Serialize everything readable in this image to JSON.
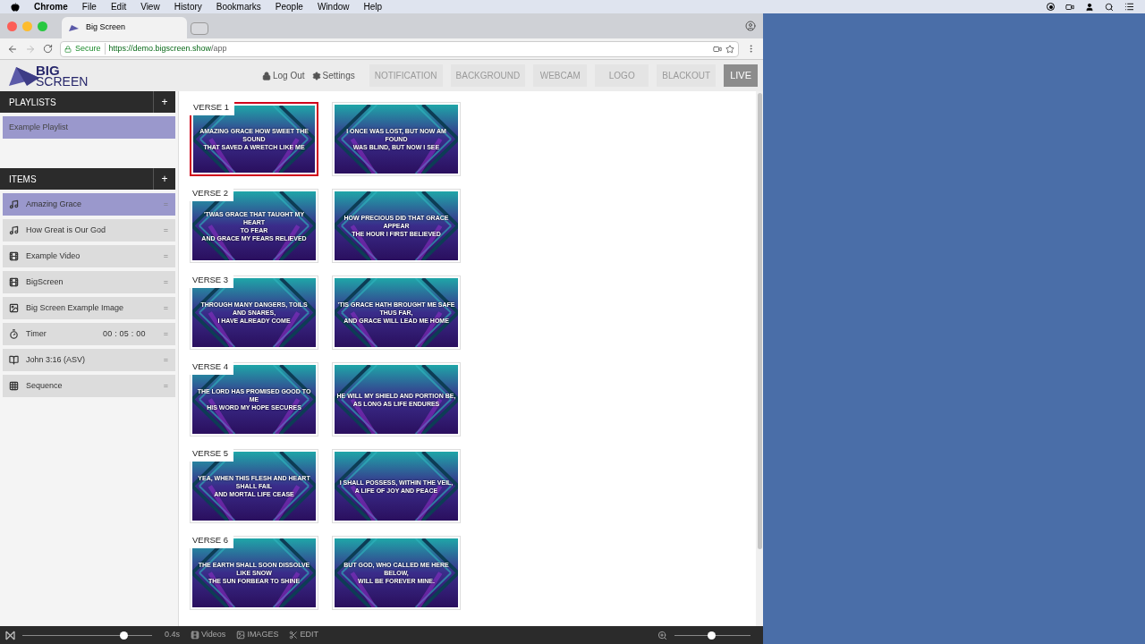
{
  "menubar": {
    "app": "Chrome",
    "menus": [
      "File",
      "Edit",
      "View",
      "History",
      "Bookmarks",
      "People",
      "Window",
      "Help"
    ]
  },
  "browser": {
    "tab_title": "Big Screen",
    "secure": "Secure",
    "url_host": "https://demo.bigscreen.show",
    "url_path": "/app"
  },
  "header": {
    "logo_top": "BIG",
    "logo_bottom": "SCREEN",
    "links": [
      {
        "kind": "lock",
        "label": "Log Out"
      },
      {
        "kind": "gear",
        "label": "Settings"
      }
    ],
    "buttons": [
      {
        "label": "NOTIFICATION",
        "disabled": true
      },
      {
        "label": "BACKGROUND",
        "disabled": true
      },
      {
        "label": "WEBCAM",
        "disabled": true
      },
      {
        "label": "LOGO",
        "disabled": true
      },
      {
        "label": "BLACKOUT",
        "disabled": true
      },
      {
        "label": "LIVE",
        "disabled": false
      }
    ]
  },
  "playlists": {
    "title": "PLAYLISTS",
    "add": "+",
    "items": [
      {
        "label": "Example Playlist",
        "selected": true
      }
    ]
  },
  "items": {
    "title": "ITEMS",
    "add": "+",
    "items": [
      {
        "kind": "music",
        "label": "Amazing Grace",
        "selected": true,
        "handle": "="
      },
      {
        "kind": "music",
        "label": "How Great is Our God",
        "selected": false,
        "handle": "="
      },
      {
        "kind": "video",
        "label": "Example Video",
        "selected": false,
        "handle": "="
      },
      {
        "kind": "video",
        "label": "BigScreen",
        "selected": false,
        "handle": "="
      },
      {
        "kind": "image",
        "label": "Big Screen Example Image",
        "selected": false,
        "handle": "="
      },
      {
        "kind": "timer",
        "label": "Timer",
        "value": "00 : 05 : 00",
        "selected": false,
        "handle": "="
      },
      {
        "kind": "book",
        "label": "John 3:16 (ASV)",
        "selected": false,
        "handle": "="
      },
      {
        "kind": "grid",
        "label": "Sequence",
        "selected": false,
        "handle": "="
      }
    ]
  },
  "verses": [
    {
      "label": "VERSE 1",
      "slides": [
        {
          "text": "AMAZING GRACE HOW SWEET THE SOUND\nTHAT SAVED A WRETCH LIKE ME",
          "selected": true
        },
        {
          "text": "I ONCE WAS LOST, BUT NOW AM FOUND\nWAS BLIND, BUT NOW I SEE",
          "selected": false
        }
      ]
    },
    {
      "label": "VERSE 2",
      "slides": [
        {
          "text": "'TWAS GRACE THAT TAUGHT MY HEART\nTO FEAR\nAND GRACE MY FEARS RELIEVED",
          "selected": false
        },
        {
          "text": "HOW PRECIOUS DID THAT GRACE APPEAR\nTHE HOUR I FIRST BELIEVED",
          "selected": false
        }
      ]
    },
    {
      "label": "VERSE 3",
      "slides": [
        {
          "text": "THROUGH MANY DANGERS, TOILS\nAND SNARES,\nI HAVE ALREADY COME",
          "selected": false
        },
        {
          "text": "'TIS GRACE HATH BROUGHT ME SAFE\nTHUS FAR,\nAND GRACE WILL LEAD ME HOME",
          "selected": false
        }
      ]
    },
    {
      "label": "VERSE 4",
      "slides": [
        {
          "text": "THE LORD HAS PROMISED GOOD TO ME\nHIS WORD MY HOPE SECURES",
          "selected": false
        },
        {
          "text": "HE WILL MY SHIELD AND PORTION BE,\nAS LONG AS LIFE ENDURES",
          "selected": false
        }
      ]
    },
    {
      "label": "VERSE 5",
      "slides": [
        {
          "text": "YEA, WHEN THIS FLESH AND HEART\nSHALL FAIL\nAND MORTAL LIFE CEASE",
          "selected": false
        },
        {
          "text": "I SHALL POSSESS, WITHIN THE VEIL,\nA LIFE OF JOY AND PEACE",
          "selected": false
        }
      ]
    },
    {
      "label": "VERSE 6",
      "slides": [
        {
          "text": "THE EARTH SHALL SOON DISSOLVE\nLIKE SNOW\nTHE SUN FORBEAR TO SHINE",
          "selected": false
        },
        {
          "text": "BUT GOD, WHO CALLED ME HERE BELOW,\nWILL BE FOREVER MINE.",
          "selected": false
        }
      ]
    }
  ],
  "bottom_bar": {
    "transition": {
      "level": 0.78
    },
    "duration": "0.4s",
    "buttons": [
      {
        "kind": "film",
        "label": "Videos"
      },
      {
        "kind": "image",
        "label": "IMAGES"
      },
      {
        "kind": "scissors",
        "label": "EDIT"
      }
    ],
    "zoom": {
      "level": 0.48
    }
  }
}
